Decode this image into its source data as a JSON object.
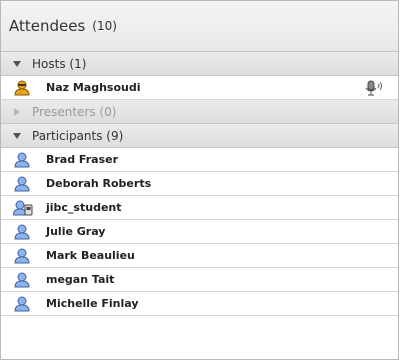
{
  "header": {
    "title": "Attendees",
    "count": "(10)"
  },
  "sections": {
    "hosts": {
      "label": "Hosts (1)",
      "attendees": [
        {
          "name": "Naz Maghsoudi",
          "role_icon": "host-user-icon",
          "mic": "microphone-icon"
        }
      ]
    },
    "presenters": {
      "label": "Presenters (0)"
    },
    "participants": {
      "label": "Participants (9)",
      "attendees": [
        {
          "name": "Brad Fraser",
          "role_icon": "participant-user-icon"
        },
        {
          "name": "Deborah Roberts",
          "role_icon": "participant-user-icon"
        },
        {
          "name": "jibc_student",
          "role_icon": "participant-phone-user-icon"
        },
        {
          "name": "Julie Gray",
          "role_icon": "participant-user-icon"
        },
        {
          "name": "Mark Beaulieu",
          "role_icon": "participant-user-icon"
        },
        {
          "name": "megan Tait",
          "role_icon": "participant-user-icon"
        },
        {
          "name": "Michelle Finlay",
          "role_icon": "participant-user-icon"
        }
      ]
    }
  },
  "colors": {
    "participant_icon": "#5f8ed6",
    "host_icon": "#e8a21f",
    "section_bg": "#e2e2e2"
  }
}
